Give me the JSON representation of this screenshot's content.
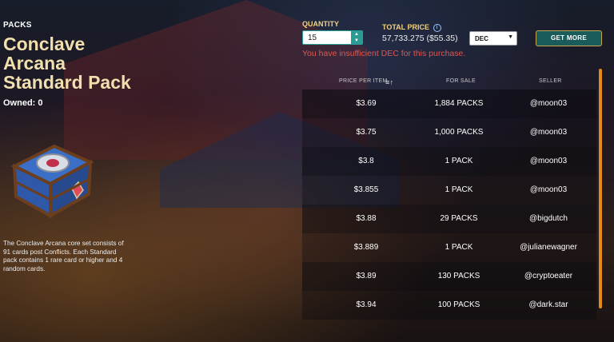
{
  "header": {
    "eyebrow": "PACKS",
    "title_line1": "Conclave",
    "title_line2": "Arcana",
    "title_line3": "Standard Pack",
    "owned": "Owned: 0"
  },
  "description": "The Conclave Arcana core set consists of 91 cards post Conflicts. Each Standard pack contains 1 rare card or higher and 4 random cards.",
  "purchase": {
    "quantity_label": "QUANTITY",
    "quantity_value": "15",
    "total_price_label": "TOTAL PRICE",
    "total_price_value": "57,733.275 ($55.35)",
    "warning": "You have insufficient DEC for this purchase.",
    "currency_selected": "DEC",
    "get_more_label": "GET MORE"
  },
  "table": {
    "headers": [
      "PRICE PER ITEM",
      "FOR SALE",
      "SELLER"
    ],
    "rows": [
      {
        "price": "$3.69",
        "for_sale": "1,884 PACKS",
        "seller": "@moon03"
      },
      {
        "price": "$3.75",
        "for_sale": "1,000 PACKS",
        "seller": "@moon03"
      },
      {
        "price": "$3.8",
        "for_sale": "1 PACK",
        "seller": "@moon03"
      },
      {
        "price": "$3.855",
        "for_sale": "1 PACK",
        "seller": "@moon03"
      },
      {
        "price": "$3.88",
        "for_sale": "29 PACKS",
        "seller": "@bigdutch"
      },
      {
        "price": "$3.889",
        "for_sale": "1 PACK",
        "seller": "@julianewagner"
      },
      {
        "price": "$3.89",
        "for_sale": "130 PACKS",
        "seller": "@cryptoeater"
      },
      {
        "price": "$3.94",
        "for_sale": "100 PACKS",
        "seller": "@dark.star"
      }
    ]
  },
  "colors": {
    "title": "#f2dfae",
    "label_gold": "#f2d27a",
    "warning": "#e0564f",
    "button_teal": "#1a5c5c",
    "scrollbar": "#e38a1c"
  }
}
